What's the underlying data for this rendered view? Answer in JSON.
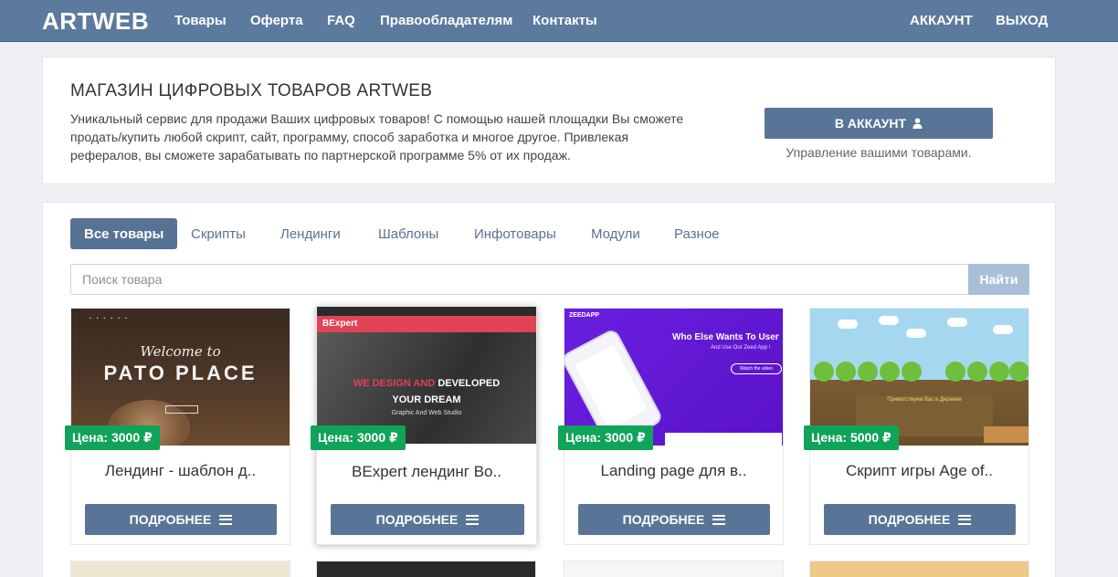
{
  "navbar": {
    "brand": "ARTWEB",
    "links": [
      "Товары",
      "Оферта",
      "FAQ",
      "Правообладателям",
      "Контакты"
    ],
    "right_links": [
      "АККАУНТ",
      "ВЫХОД"
    ]
  },
  "intro": {
    "title": "МАГАЗИН ЦИФРОВЫХ ТОВАРОВ ARTWEB",
    "lines": [
      "Уникальный сервис для продажи Ваших цифровых товаров! С помощью нашей площадки Вы сможете",
      "продать/купить любой скрипт, сайт, программу, способ заработка и многое другое. Привлекая",
      "рефералов, вы сможете зарабатывать по партнерской программе 5% от их продаж."
    ],
    "account_button": "В АККАУНТ",
    "account_hint": "Управление вашими товарами."
  },
  "tabs": [
    "Все товары",
    "Скрипты",
    "Лендинги",
    "Шаблоны",
    "Инфотовары",
    "Модули",
    "Разное"
  ],
  "active_tab": "Все товары",
  "search": {
    "placeholder": "Поиск товара",
    "button": "Найти"
  },
  "products": [
    {
      "price": "Цена: 3000 ₽",
      "name": "Лендинг - шаблон д..",
      "button": "ПОДРОБНЕЕ",
      "thumb_text": [
        "Welcome to",
        "PATO PLACE"
      ]
    },
    {
      "price": "Цена: 3000 ₽",
      "name": "BExpert лендинг Во..",
      "button": "ПОДРОБНЕЕ",
      "thumb_text": [
        "BExpert",
        "WE DESIGN AND",
        "DEVELOPED",
        "YOUR DREAM",
        "Graphic And Web Studio"
      ]
    },
    {
      "price": "Цена: 3000 ₽",
      "name": "Landing page для в..",
      "button": "ПОДРОБНЕЕ",
      "thumb_text": [
        "ZEEDAPP",
        "Who Else Wants To User",
        "And Use Our Zeed App !",
        "Watch the video"
      ]
    },
    {
      "price": "Цена: 5000 ₽",
      "name": "Скрипт игры Age of..",
      "button": "ПОДРОБНЕЕ",
      "thumb_text": [
        "Приветствуем Вас в Деревне"
      ]
    }
  ],
  "colors": {
    "navbar": "#5c7a9e",
    "primary_button": "#587597",
    "price_badge": "#10a35a",
    "search_button": "#a9bfd8"
  },
  "icons": {
    "account_button": "user-icon",
    "more_button": "menu-icon"
  }
}
